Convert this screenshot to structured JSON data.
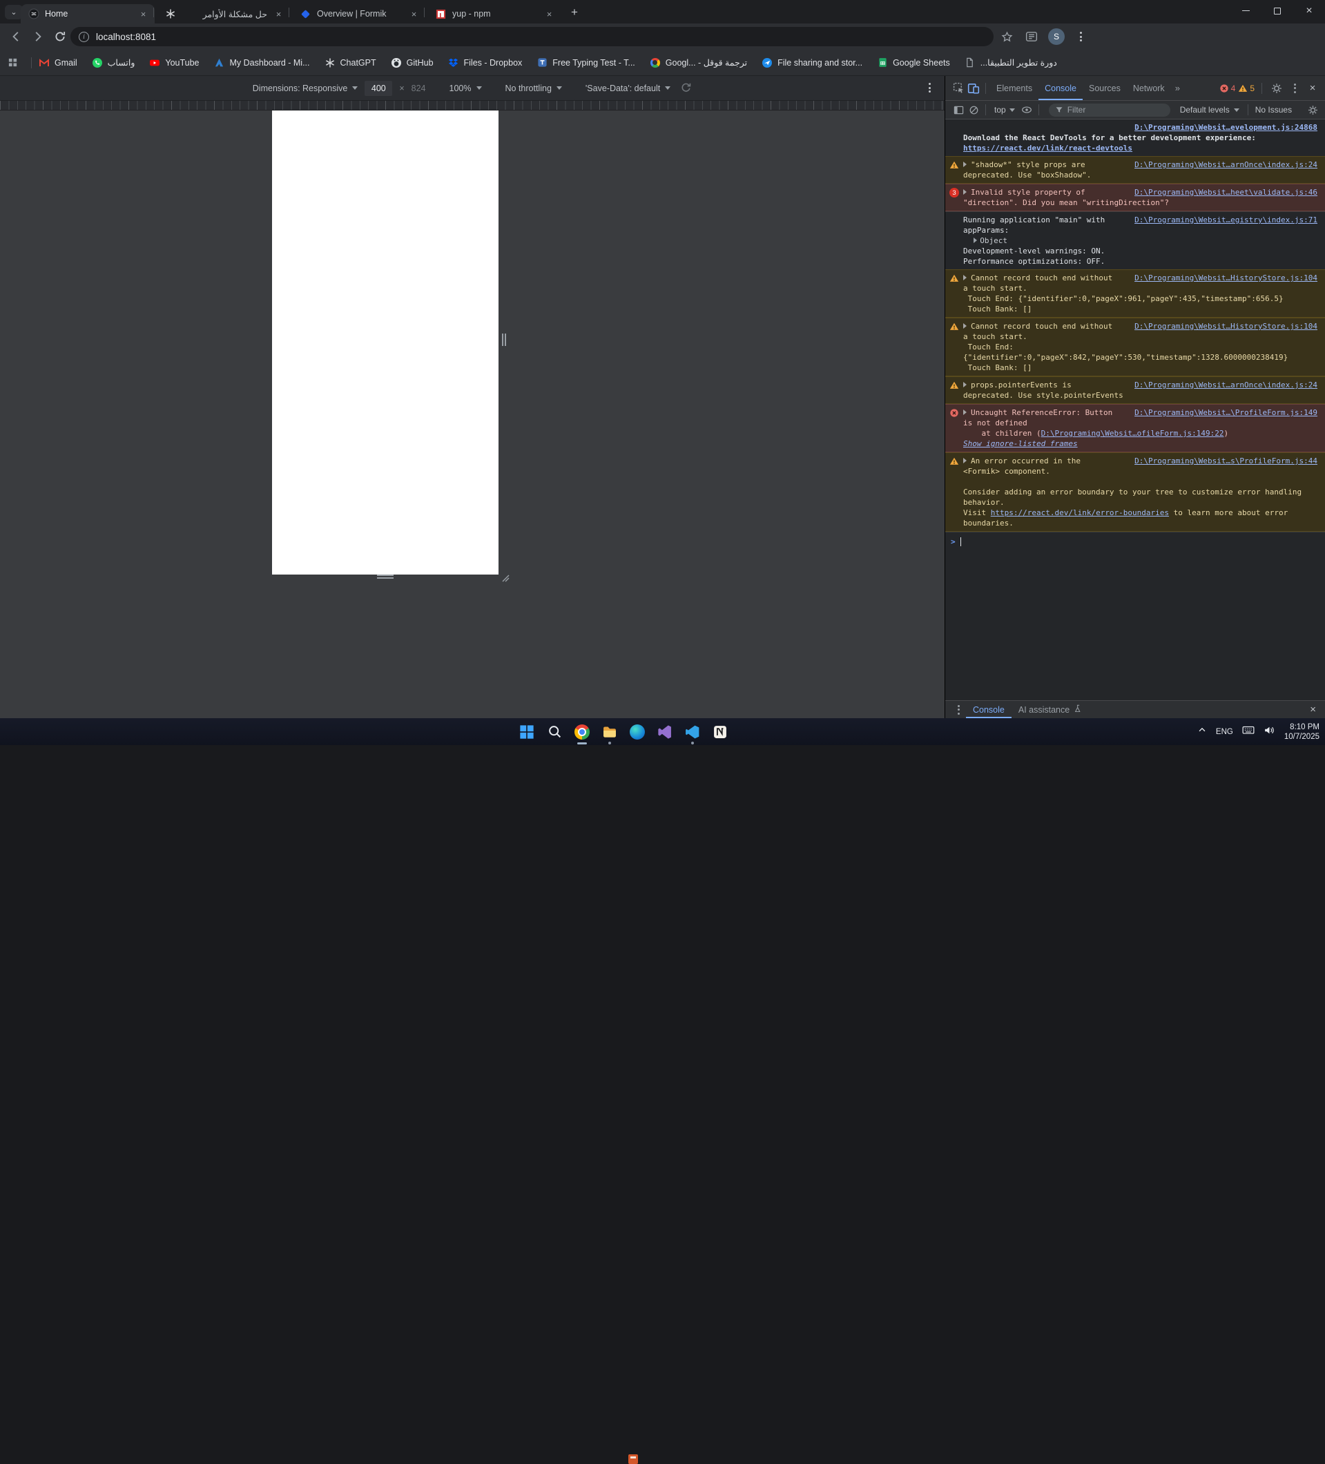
{
  "browser": {
    "tabs": [
      {
        "title": "Home",
        "favicon": "home-logo",
        "active": true
      },
      {
        "title": "حل مشكلة الأوامر",
        "favicon": "chatgpt",
        "rtl": true
      },
      {
        "title": "Overview | Formik",
        "favicon": "formik"
      },
      {
        "title": "yup - npm",
        "favicon": "npm"
      }
    ],
    "new_tab_label": "+",
    "toolbar": {
      "url": "localhost:8081",
      "profile_initial": "S"
    },
    "bookmarks": [
      {
        "label": "Gmail",
        "icon": "gmail"
      },
      {
        "label": "واتساب",
        "icon": "whatsapp",
        "rtl": true
      },
      {
        "label": "YouTube",
        "icon": "youtube"
      },
      {
        "label": "My Dashboard - Mi...",
        "icon": "dashboard"
      },
      {
        "label": "ChatGPT",
        "icon": "chatgpt"
      },
      {
        "label": "GitHub",
        "icon": "github"
      },
      {
        "label": "Files - Dropbox",
        "icon": "dropbox"
      },
      {
        "label": "Free Typing Test - T...",
        "icon": "typing"
      },
      {
        "label": "Googl... - ترجمة قوقل",
        "icon": "google"
      },
      {
        "label": "File sharing and stor...",
        "icon": "fileshare"
      },
      {
        "label": "Google Sheets",
        "icon": "sheets"
      },
      {
        "label": "دورة تطوير التطبيقا...",
        "icon": "page",
        "rtl": true
      }
    ]
  },
  "device_toolbar": {
    "dimensions": "Dimensions: Responsive",
    "width": "400",
    "times": "×",
    "height": "824",
    "zoom": "100%",
    "throttle": "No throttling",
    "save_data": "'Save-Data': default"
  },
  "devtools": {
    "tabs": [
      "Elements",
      "Console",
      "Sources",
      "Network"
    ],
    "active_tab": "Console",
    "more_tabs": "»",
    "error_count": "4",
    "warning_count": "5",
    "toolbar": {
      "context": "top",
      "filter_placeholder": "Filter",
      "levels": "Default levels",
      "issues": "No Issues"
    },
    "messages": [
      {
        "type": "log",
        "bold": true,
        "link_own_line": true,
        "link": "D:\\Programing\\Websit…evelopment.js:24868",
        "parts": [
          {
            "t": "Download the React DevTools for a better development experience:\n"
          },
          {
            "a": "https://react.dev/link/react-devtools"
          }
        ]
      },
      {
        "type": "warn",
        "icon": "warn",
        "caret": true,
        "first": "\"shadow*\" style props are",
        "link": "D:\\Programing\\Websit…arnOnce\\index.js:24",
        "parts": [
          {
            "t": "deprecated. Use \"boxShadow\"."
          }
        ]
      },
      {
        "type": "error",
        "badge": "3",
        "caret": true,
        "first": "Invalid style property of",
        "link": "D:\\Programing\\Websit…heet\\validate.js:46",
        "parts": [
          {
            "t": "\"direction\". Did you mean \"writingDirection\"?"
          }
        ]
      },
      {
        "type": "log",
        "first": "Running application \"main\" with",
        "link": "D:\\Programing\\Websit…egistry\\index.js:71",
        "parts": [
          {
            "t": "appParams:\n  "
          },
          {
            "obj": "Object"
          },
          {
            "t": "\nDevelopment-level warnings: ON.\nPerformance optimizations: OFF."
          }
        ]
      },
      {
        "type": "warn",
        "icon": "warn",
        "caret": true,
        "first": "Cannot record touch end without",
        "link": "D:\\Programing\\Websit…HistoryStore.js:104",
        "parts": [
          {
            "t": "a touch start.\n Touch End: {\"identifier\":0,\"pageX\":961,\"pageY\":435,\"timestamp\":656.5}\n Touch Bank: []"
          }
        ]
      },
      {
        "type": "warn",
        "icon": "warn",
        "caret": true,
        "first": "Cannot record touch end without",
        "link": "D:\\Programing\\Websit…HistoryStore.js:104",
        "parts": [
          {
            "t": "a touch start.\n Touch End:\n{\"identifier\":0,\"pageX\":842,\"pageY\":530,\"timestamp\":1328.6000000238419}\n Touch Bank: []"
          }
        ]
      },
      {
        "type": "warn",
        "icon": "warn",
        "caret": true,
        "first": "props.pointerEvents is",
        "link": "D:\\Programing\\Websit…arnOnce\\index.js:24",
        "parts": [
          {
            "t": "deprecated. Use style.pointerEvents"
          }
        ]
      },
      {
        "type": "error",
        "icon": "errorx",
        "caret": true,
        "first": "Uncaught ReferenceError: Button",
        "link": "D:\\Programing\\Websit…\\ProfileForm.js:149",
        "parts": [
          {
            "t": "is not defined\n    at children ("
          },
          {
            "a": "D:\\Programing\\Websit…ofileForm.js:149:22"
          },
          {
            "t": ")\n"
          },
          {
            "a": "Show ignore-listed frames",
            "italic": true
          }
        ]
      },
      {
        "type": "warn",
        "icon": "warn",
        "caret": true,
        "first": "An error occurred in the",
        "link": "D:\\Programing\\Websit…s\\ProfileForm.js:44",
        "parts": [
          {
            "t": "<Formik> component.\n\nConsider adding an error boundary to your tree to customize error handling\nbehavior.\nVisit "
          },
          {
            "a": "https://react.dev/link/error-boundaries"
          },
          {
            "t": " to learn more about error\nboundaries."
          }
        ]
      }
    ],
    "prompt_chevron": ">",
    "footer": {
      "tabs": [
        "Console",
        "AI assistance"
      ],
      "active": "Console"
    }
  },
  "taskbar": {
    "icons": [
      {
        "name": "start"
      },
      {
        "name": "search"
      },
      {
        "name": "chrome",
        "indicator": "pill"
      },
      {
        "name": "file-explorer",
        "indicator": "dot"
      },
      {
        "name": "edge"
      },
      {
        "name": "visual-studio"
      },
      {
        "name": "vscode",
        "indicator": "dot"
      },
      {
        "name": "notion"
      }
    ],
    "tray": {
      "lang": "ENG",
      "time": "8:10 PM",
      "date": "10/7/2025"
    }
  }
}
